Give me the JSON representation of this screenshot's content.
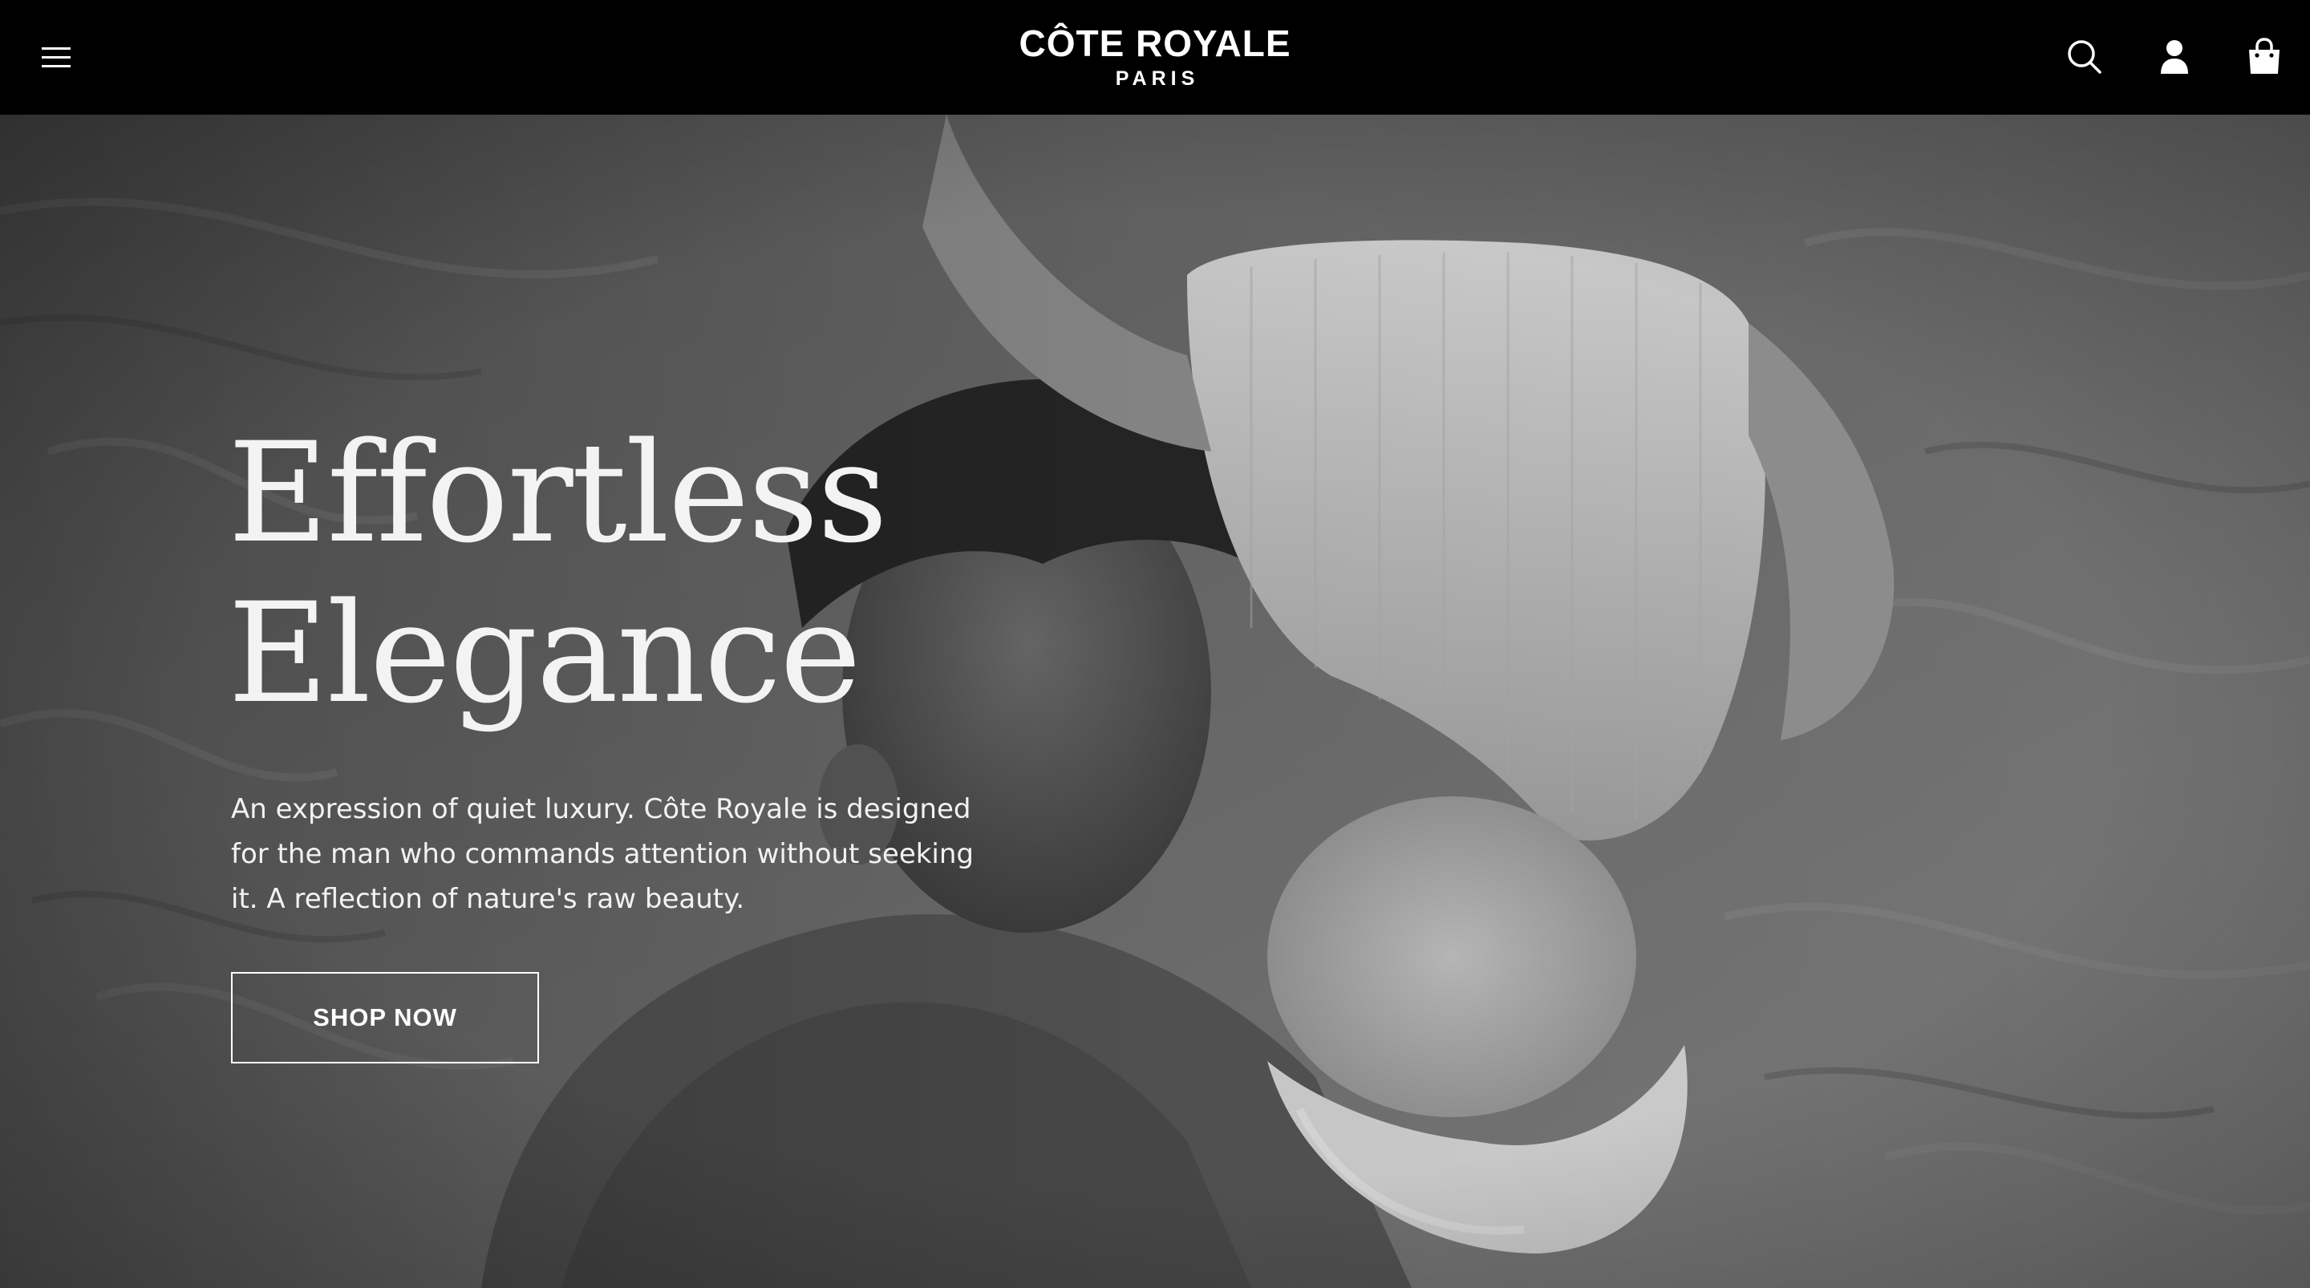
{
  "header": {
    "brand_name": "CÔTE ROYALE",
    "brand_sub": "PARIS",
    "icons": [
      "hamburger-menu-icon",
      "search-icon",
      "account-icon",
      "cart-icon"
    ],
    "background": "#000000"
  },
  "hero": {
    "title_line1": "Effortless",
    "title_line2": "Elegance",
    "description": "An expression of quiet luxury. Côte Royale is designed for the man who commands attention without seeking it. A reflection of nature's raw beauty.",
    "cta_label": "SHOP NOW",
    "text_color": "#ffffff"
  }
}
